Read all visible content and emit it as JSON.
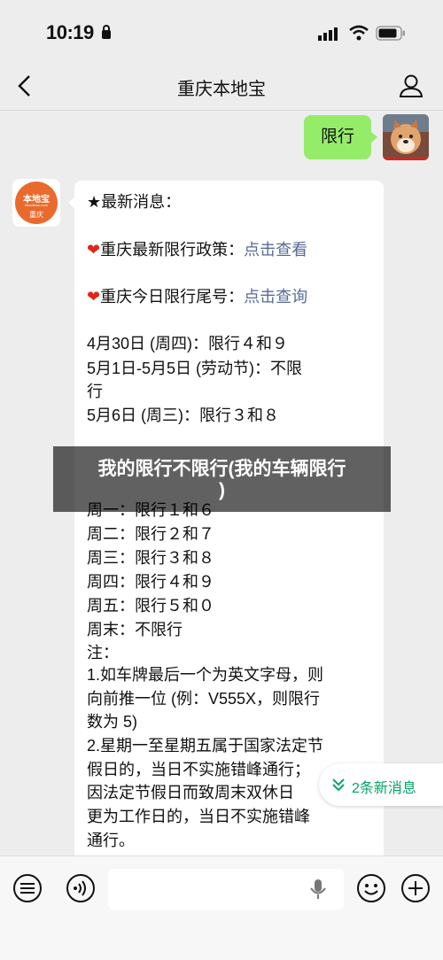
{
  "status_bar": {
    "time": "10:19"
  },
  "nav": {
    "title": "重庆本地宝"
  },
  "messages": {
    "outgoing_text": "限行",
    "bot_avatar": {
      "logo_text": "本地宝",
      "logo_url": "Bendibao.com",
      "logo_city": "重庆"
    },
    "incoming": {
      "header": "★最新消息：",
      "policy_prefix": "重庆最新限行政策：",
      "policy_link": "点击查看",
      "today_prefix": "重庆今日限行尾号：",
      "today_link": "点击查询",
      "lines": [
        "4月30日 (周四)：限行４和９",
        "5月1日-5月5日 (劳动节)：不限",
        "行",
        "5月6日 (周三)：限行３和８",
        "周一：限行１和６",
        "周二：限行２和７",
        "周三：限行３和８",
        "周四：限行４和９",
        "周五：限行５和０",
        "周末：不限行",
        "注：",
        "1.如车牌最后一个为英文字母，则",
        "向前推一位 (例：V555X，则限行",
        "数为 5)",
        "2.星期一至星期五属于国家法定节",
        "假日的，当日不实施错峰通行；",
        "因法定节假日而致周末双休日",
        "更为工作日的，当日不实施错峰",
        "通行。"
      ]
    }
  },
  "overlay": {
    "line1": "我的限行不限行(我的车辆限行",
    "line2": ")"
  },
  "new_messages_badge": {
    "label": "2条新消息"
  },
  "colors": {
    "outgoing_bubble": "#95ec69",
    "link": "#576b95",
    "badge_text": "#07a266",
    "background": "#ededed"
  },
  "icons": [
    "back-arrow-icon",
    "profile-icon",
    "voice-icon",
    "microphone-icon",
    "emoji-icon",
    "plus-icon",
    "menu-list-icon",
    "chevron-double-down-icon"
  ]
}
